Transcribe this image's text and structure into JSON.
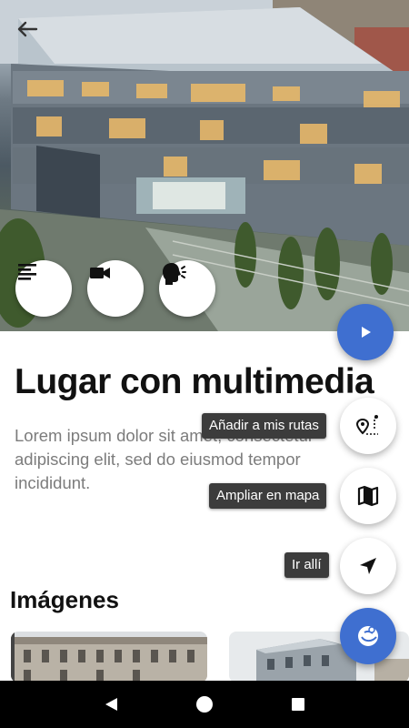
{
  "header": {
    "back_icon": "arrow-back-icon"
  },
  "hero": {
    "description": "",
    "media_buttons": [
      {
        "icon": "text-align-left-icon"
      },
      {
        "icon": "videocam-icon"
      },
      {
        "icon": "speaking-head-icon"
      }
    ],
    "play_icon": "play-icon"
  },
  "place": {
    "title": "Lugar con multimedia",
    "description": "Lorem ipsum dolor sit amet, consectetur adipiscing elit, sed do eiusmod tempor incididunt."
  },
  "images_section": {
    "title": "Imágenes"
  },
  "actions": [
    {
      "label": "Añadir a mis rutas",
      "icon": "route-pin-icon"
    },
    {
      "label": "Ampliar en mapa",
      "icon": "map-icon"
    },
    {
      "label": "Ir allí",
      "icon": "navigation-arrow-icon"
    }
  ],
  "main_fab": {
    "icon": "close-menu-icon"
  },
  "colors": {
    "accent": "#3f6fd0",
    "tooltip_bg": "#3c3c3c",
    "text_primary": "#111111",
    "text_secondary": "#7c7c7c"
  },
  "system_nav": {
    "back": "back-triangle-icon",
    "home": "home-circle-icon",
    "recents": "recents-square-icon"
  }
}
